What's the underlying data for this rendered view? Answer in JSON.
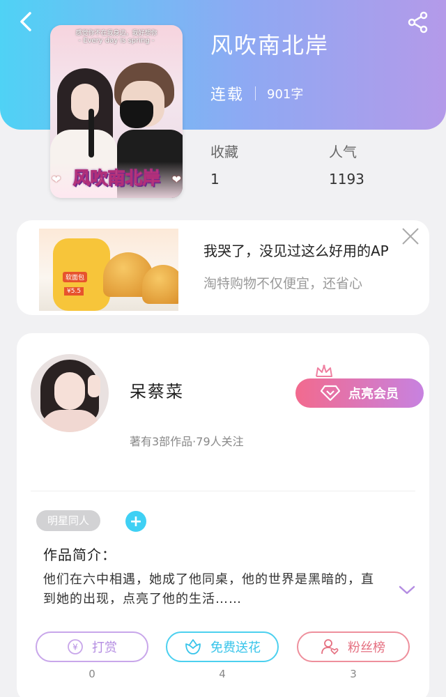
{
  "header": {
    "book_title": "风吹南北岸",
    "status": "连载",
    "word_count": "901字"
  },
  "cover": {
    "caption_line1": "感觉你不在我身边，我好想你",
    "caption_line2": "- Every day is spring -",
    "title_art": "风吹南北岸"
  },
  "stats": {
    "favorites_label": "收藏",
    "favorites_value": "1",
    "popularity_label": "人气",
    "popularity_value": "1193"
  },
  "ad": {
    "title": "我哭了，没见过这么好用的AP",
    "subtitle": "淘特购物不仅便宜，还省心",
    "package_label": "软面包",
    "package_price": "¥5.5"
  },
  "author": {
    "name": "呆蔡菜",
    "meta": "著有3部作品·79人关注",
    "vip_label": "点亮会员"
  },
  "work": {
    "tag": "明星同人",
    "intro_label": "作品简介：",
    "intro_text": "他们在六中相遇，她成了他同桌，他的世界是黑暗的，直到她的出现，点亮了他的生活……"
  },
  "actions": {
    "reward_label": "打赏",
    "reward_count": "0",
    "flower_label": "免费送花",
    "flower_count": "4",
    "fans_label": "粉丝榜",
    "fans_count": "3"
  },
  "colors": {
    "header_gradient": [
      "#4fd2f5",
      "#8ea9f3",
      "#b49ae9"
    ],
    "vip_gradient": [
      "#f26a8e",
      "#c782e0"
    ],
    "accent_cyan": "#3fd0f4"
  }
}
